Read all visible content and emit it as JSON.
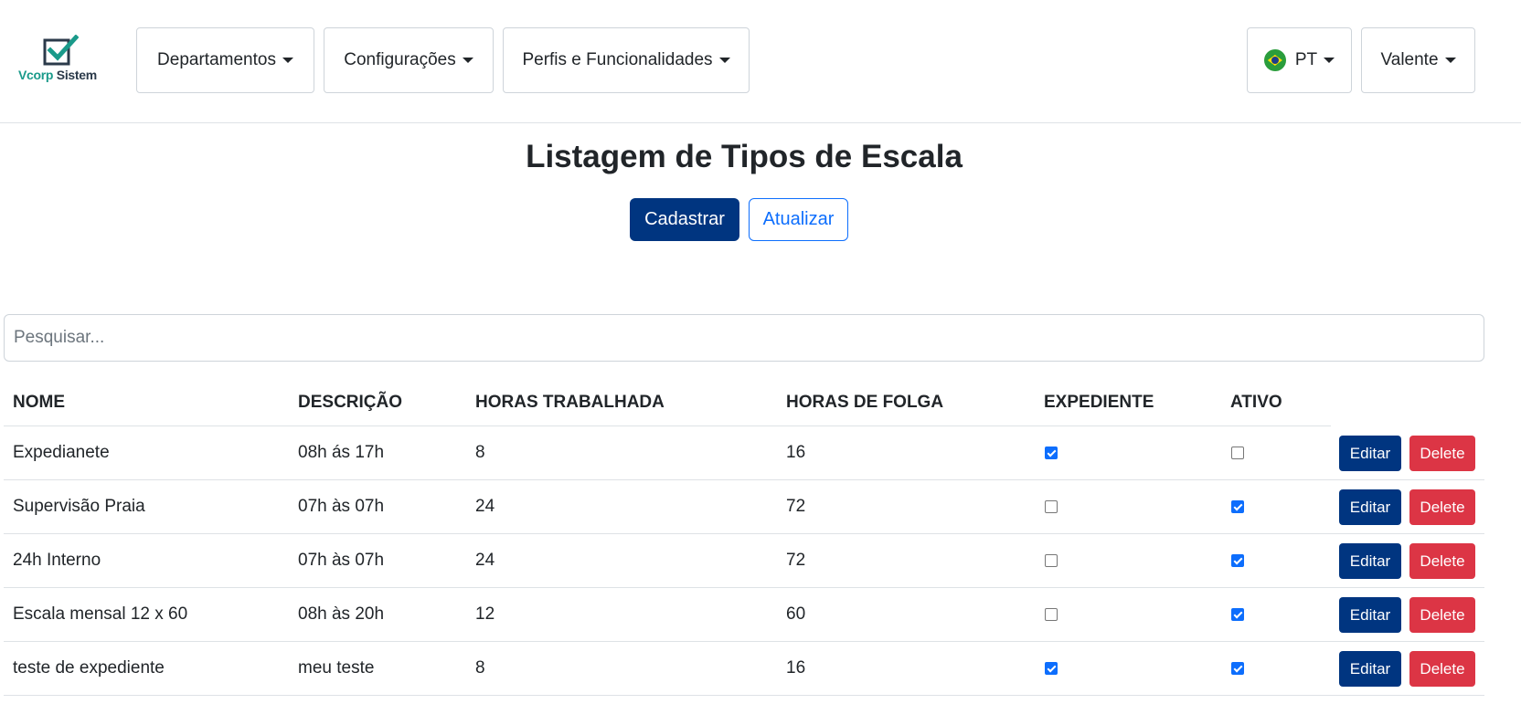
{
  "brand": {
    "name_part1": "Vcorp",
    "name_part2": "Sistem"
  },
  "nav": {
    "departamentos": "Departamentos",
    "configuracoes": "Configurações",
    "perfis": "Perfis e Funcionalidades",
    "language": "PT",
    "user": "Valente"
  },
  "page": {
    "title": "Listagem de Tipos de Escala",
    "cadastrar": "Cadastrar",
    "atualizar": "Atualizar",
    "search_placeholder": "Pesquisar..."
  },
  "table": {
    "headers": [
      "NOME",
      "DESCRIÇÃO",
      "HORAS TRABALHADA",
      "HORAS DE FOLGA",
      "EXPEDIENTE",
      "ATIVO"
    ],
    "edit_label": "Editar",
    "delete_label": "Delete",
    "rows": [
      {
        "nome": "Expedianete",
        "descricao": "08h ás 17h",
        "horas_trabalhada": "8",
        "horas_folga": "16",
        "expediente": true,
        "ativo": false
      },
      {
        "nome": "Supervisão Praia",
        "descricao": "07h às 07h",
        "horas_trabalhada": "24",
        "horas_folga": "72",
        "expediente": false,
        "ativo": true
      },
      {
        "nome": "24h Interno",
        "descricao": "07h às 07h",
        "horas_trabalhada": "24",
        "horas_folga": "72",
        "expediente": false,
        "ativo": true
      },
      {
        "nome": "Escala mensal 12 x 60",
        "descricao": "08h às 20h",
        "horas_trabalhada": "12",
        "horas_folga": "60",
        "expediente": false,
        "ativo": true
      },
      {
        "nome": "teste de expediente",
        "descricao": "meu teste",
        "horas_trabalhada": "8",
        "horas_folga": "16",
        "expediente": true,
        "ativo": true
      }
    ]
  }
}
